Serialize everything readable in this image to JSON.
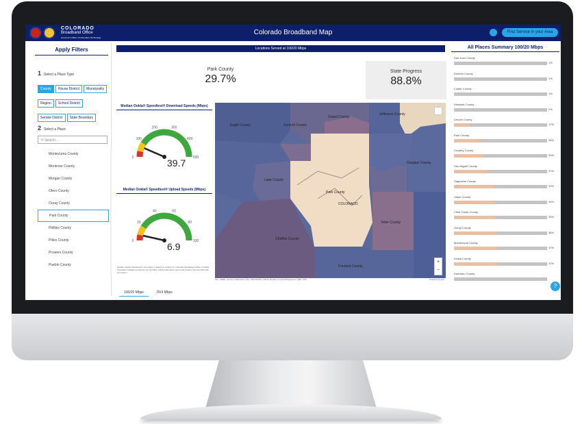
{
  "header": {
    "brand_line1": "COLORADO",
    "brand_line2": "Broadband Office",
    "brand_line3": "Governor's Office of Information Technology",
    "title": "Colorado Broadband Map",
    "find_button": "Find Service in your Area"
  },
  "filters": {
    "title": "Apply Filters",
    "step1_label": "Select a Place Type",
    "step2_label": "Select a Place",
    "place_types": [
      "County",
      "House District",
      "Municipality",
      "Region",
      "School District",
      "Senate District",
      "State Boundary"
    ],
    "selected_type": "County",
    "search_placeholder": "Search...",
    "places": [
      "Montezuma County",
      "Montrose County",
      "Morgan County",
      "Otero County",
      "Ouray County",
      "Park County",
      "Phillips County",
      "Pitkin County",
      "Prowers County",
      "Pueblo County"
    ],
    "selected_place": "Park County"
  },
  "center": {
    "band_title": "Locations Served at 100/20 Mbps",
    "kpi_place_label": "Park County",
    "kpi_place_value": "29.7%",
    "kpi_state_label": "State Progress",
    "kpi_state_value": "88.8%",
    "download_title": "Median Ookla® Speedtest® Download Speeds (Mbps)",
    "download_value": "39.7",
    "download_fraction": 0.13,
    "download_ticks": [
      "0",
      "100",
      "200",
      "300",
      "400",
      "500"
    ],
    "upload_title": "Median Ookla® Speedtest® Upload Speeds (Mbps)",
    "upload_value": "6.9",
    "upload_fraction": 0.07,
    "upload_ticks": [
      "0",
      "20",
      "40",
      "60",
      "80",
      "100"
    ],
    "note": "Median Ookla® Speedtest® information is based on analysis by Colorado Broadband Office of Ookla Speedtest Intelligence data for Q1-Q4 2023. Ookla trademarks used under license and reprinted with permission.",
    "map_labels": [
      "Park County",
      "COLORADO",
      "Teller County",
      "Chaffee County",
      "Lake County",
      "Summit County",
      "Eagle County",
      "Grand County",
      "Fremont County",
      "Jefferson County",
      "Douglas County"
    ],
    "attribution": "Esri, HERE, Garmin, SafeGraph, FAO, METI/NASA, USGS, Bureau of Land Management, EPA, NPS",
    "powered": "Powered by Esri",
    "tabs": [
      "100/20 Mbps",
      "25/3 Mbps"
    ],
    "active_tab": "100/20 Mbps",
    "zoom_in": "+",
    "zoom_out": "−"
  },
  "summary": {
    "title": "All Places Summary 100/20 Mbps",
    "items": [
      {
        "name": "San Juan County",
        "pct": "1%",
        "value": 1
      },
      {
        "name": "Dolores County",
        "pct": "1%",
        "value": 1
      },
      {
        "name": "Custer County",
        "pct": "1%",
        "value": 1
      },
      {
        "name": "Hinsdale County",
        "pct": "2%",
        "value": 2
      },
      {
        "name": "Lincoln County",
        "pct": "17%",
        "value": 17
      },
      {
        "name": "Park County",
        "pct": "28%",
        "value": 28
      },
      {
        "name": "Crowley County",
        "pct": "33%",
        "value": 33
      },
      {
        "name": "San Miguel County",
        "pct": "37%",
        "value": 37
      },
      {
        "name": "Saguache County",
        "pct": "43%",
        "value": 43
      },
      {
        "name": "Gilpin County",
        "pct": "44%",
        "value": 44
      },
      {
        "name": "Clear Creek County",
        "pct": "45%",
        "value": 45
      },
      {
        "name": "Ouray County",
        "pct": "46%",
        "value": 46
      },
      {
        "name": "Montezuma County",
        "pct": "47%",
        "value": 47
      },
      {
        "name": "Kiowa County",
        "pct": "47%",
        "value": 47
      },
      {
        "name": "Huerfano County",
        "pct": "",
        "value": 0
      }
    ]
  },
  "colors": {
    "navy": "#0d1f6b",
    "accent": "#2aa6e6",
    "bar_fill": "#e8bfa2",
    "map_blue": "#5a6a9c",
    "map_peach": "#f0d8c0",
    "map_mauve": "#8c6f8f"
  }
}
